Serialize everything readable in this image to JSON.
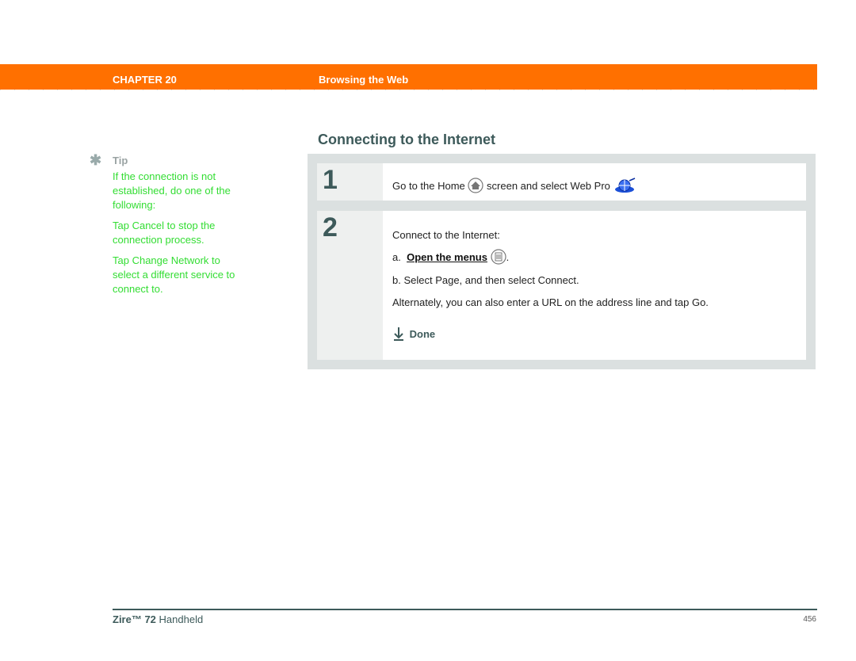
{
  "header": {
    "chapter": "CHAPTER 20",
    "section": "Browsing the Web",
    "bar_color": "#ff7000"
  },
  "tip": {
    "icon": "asterisk-icon",
    "label": "Tip",
    "paragraphs": [
      "If the connection is not established, do one of the following:",
      "Tap Cancel to stop the connection process.",
      "Tap Change Network to select a different service to connect to."
    ]
  },
  "main": {
    "heading": "Connecting to the Internet",
    "steps": [
      {
        "number": "1",
        "text_before": "Go to the Home",
        "text_after": "screen and select Web Pro",
        "icons": [
          "home-icon",
          "web-pro-globe-icon"
        ]
      },
      {
        "number": "2",
        "intro": "Connect to the Internet:",
        "sub_a_prefix": "a.",
        "sub_a_link": "Open the menus",
        "sub_a_suffix": ".",
        "sub_b": "b.  Select Page, and then select Connect.",
        "alt": "Alternately, you can also enter a URL on the address line and tap Go.",
        "done": "Done"
      }
    ]
  },
  "footer": {
    "product_bold": "Zire™ 72",
    "product_rest": " Handheld",
    "page": "456"
  }
}
